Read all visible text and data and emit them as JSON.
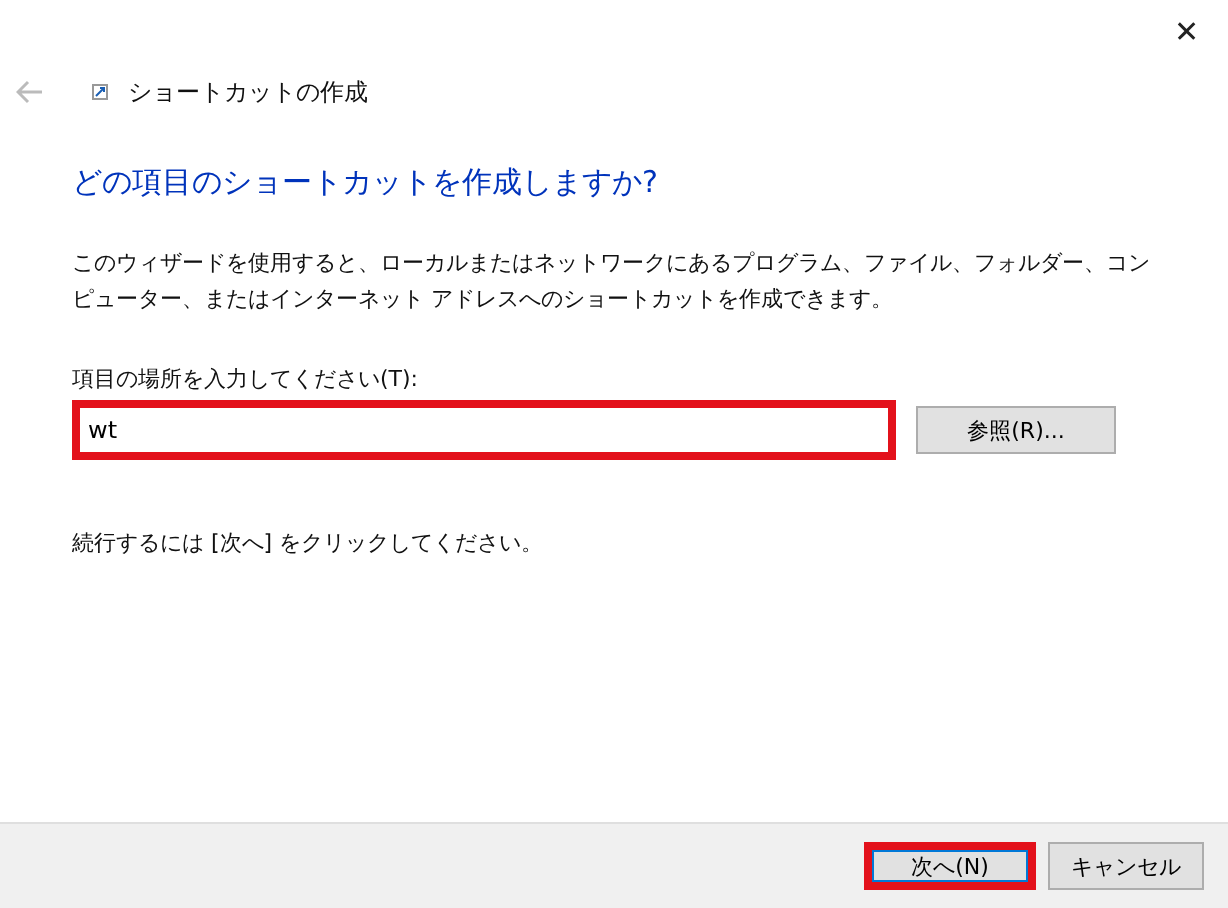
{
  "window": {
    "title": "ショートカットの作成",
    "close": "✕",
    "back_enabled": false
  },
  "heading": "どの項目のショートカットを作成しますか?",
  "description": "このウィザードを使用すると、ローカルまたはネットワークにあるプログラム、ファイル、フォルダー、コンピューター、またはインターネット アドレスへのショートカットを作成できます。",
  "location": {
    "label": "項目の場所を入力してください(T):",
    "value": "wt",
    "highlighted": true
  },
  "browse_button": {
    "label": "参照(R)..."
  },
  "hint": "続行するには [次へ] をクリックしてください。",
  "buttons": [
    {
      "label": "次へ(N)",
      "highlighted": true,
      "focused": true
    },
    {
      "label": "キャンセル",
      "highlighted": false,
      "focused": false
    }
  ]
}
